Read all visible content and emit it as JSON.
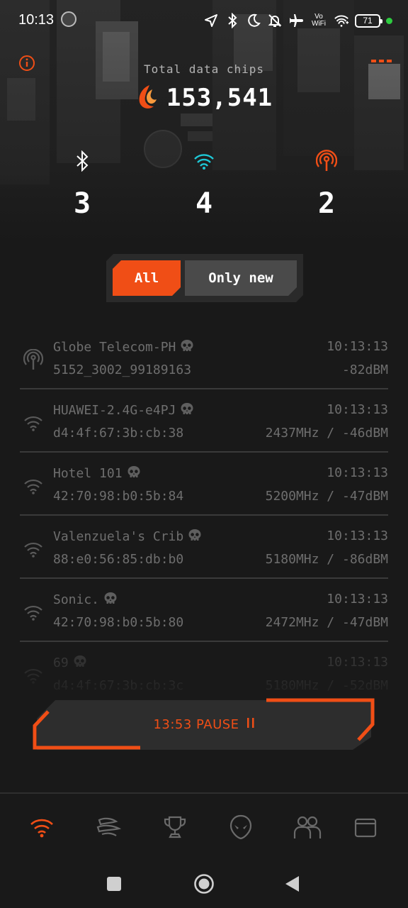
{
  "status_bar": {
    "time": "10:13",
    "vowifi_top": "Vo",
    "vowifi_bottom": "WiFi",
    "battery": "71",
    "icons": [
      "location-arrow-icon",
      "bluetooth-icon",
      "moon-icon",
      "bell-off-icon",
      "airplane-icon",
      "vowifi-icon",
      "wifi-plus-icon",
      "battery-icon"
    ]
  },
  "header": {
    "chips_label": "Total data chips",
    "chips_value": "153,541"
  },
  "counters": {
    "bluetooth": "3",
    "wifi": "4",
    "cell": "2"
  },
  "filter": {
    "all_label": "All",
    "new_label": "Only new",
    "selected": "All"
  },
  "networks": [
    {
      "type": "cell",
      "name": "Globe Telecom-PH",
      "time": "10:13:13",
      "id": "5152_3002_99189163",
      "signal": "-82dBM"
    },
    {
      "type": "wifi",
      "name": "HUAWEI-2.4G-e4PJ",
      "time": "10:13:13",
      "id": "d4:4f:67:3b:cb:38",
      "signal": "2437MHz / -46dBM"
    },
    {
      "type": "wifi",
      "name": "Hotel 101",
      "time": "10:13:13",
      "id": "42:70:98:b0:5b:84",
      "signal": "5200MHz / -47dBM"
    },
    {
      "type": "wifi",
      "name": "Valenzuela's Crib",
      "time": "10:13:13",
      "id": "88:e0:56:85:db:b0",
      "signal": "5180MHz / -86dBM"
    },
    {
      "type": "wifi",
      "name": "Sonic.",
      "time": "10:13:13",
      "id": "42:70:98:b0:5b:80",
      "signal": "2472MHz / -47dBM"
    },
    {
      "type": "wifi",
      "name": "69",
      "time": "10:13:13",
      "id": "d4:4f:67:3b:cb:3c",
      "signal": "5180MHz / -52dBM"
    }
  ],
  "pause_button": {
    "label": "13:53 PAUSE",
    "icon": "pause-icon"
  },
  "bottom_nav": [
    "wifi-scan-icon",
    "chips-icon",
    "trophy-icon",
    "alien-icon",
    "friends-icon",
    "wallet-icon"
  ],
  "colors": {
    "accent": "#f04e16",
    "wifi_cyan": "#1ec8d6",
    "background": "#191919",
    "muted_text": "#6e6e6e"
  }
}
